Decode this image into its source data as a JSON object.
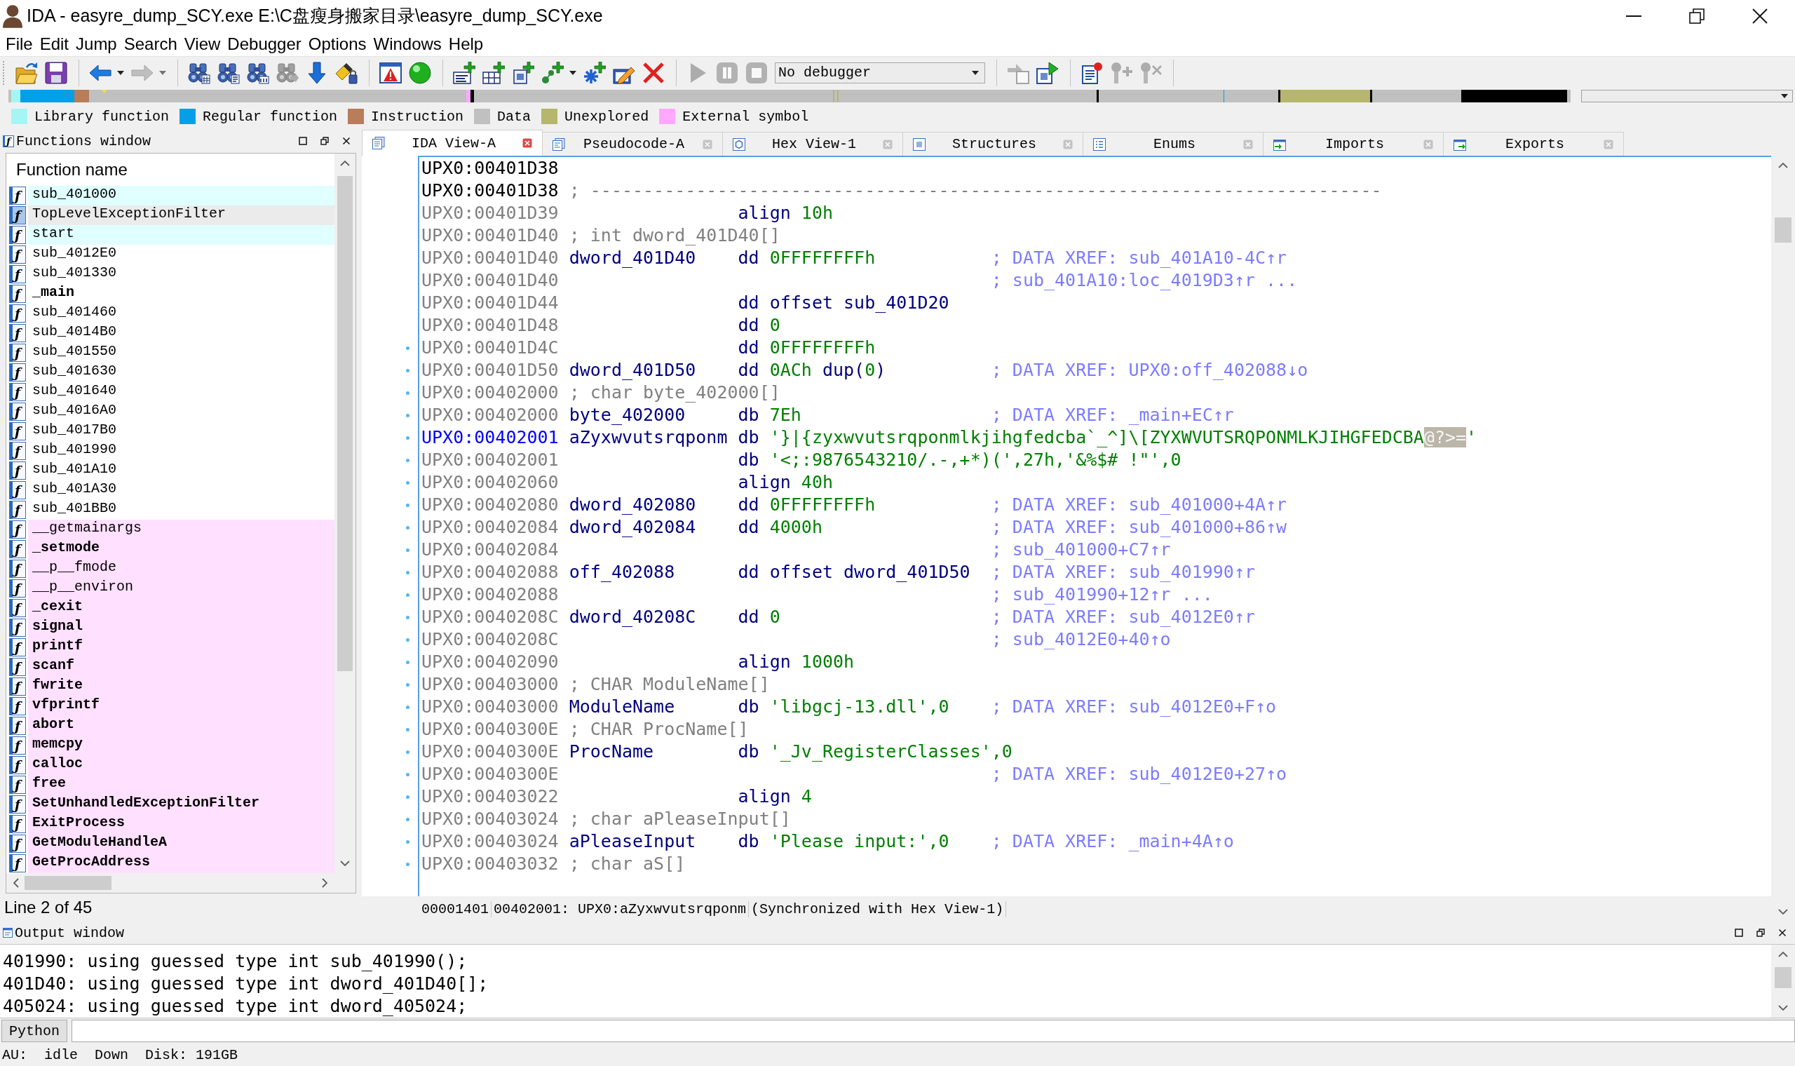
{
  "window": {
    "title": "IDA - easyre_dump_SCY.exe E:\\C盘瘦身搬家目录\\easyre_dump_SCY.exe"
  },
  "menu": [
    "File",
    "Edit",
    "Jump",
    "Search",
    "View",
    "Debugger",
    "Options",
    "Windows",
    "Help"
  ],
  "toolbar": [
    [
      {
        "kind": "open",
        "disabled": false,
        "dropdown": false
      },
      {
        "kind": "save",
        "disabled": false,
        "dropdown": false
      }
    ],
    [
      {
        "kind": "back",
        "disabled": false,
        "dropdown": true
      },
      {
        "kind": "forward",
        "disabled": true,
        "dropdown": true
      }
    ],
    [
      {
        "kind": "findhex",
        "disabled": false,
        "dropdown": false
      },
      {
        "kind": "findtext",
        "disabled": false,
        "dropdown": false
      },
      {
        "kind": "findbinary",
        "disabled": false,
        "dropdown": false
      },
      {
        "kind": "findnext",
        "disabled": true,
        "dropdown": false
      },
      {
        "kind": "jump",
        "disabled": false,
        "dropdown": false
      },
      {
        "kind": "lock",
        "disabled": false,
        "dropdown": false
      }
    ],
    [
      {
        "kind": "warning",
        "disabled": false,
        "dropdown": false
      },
      {
        "kind": "ball",
        "disabled": false,
        "dropdown": false
      }
    ],
    [
      {
        "kind": "addcode",
        "disabled": false,
        "dropdown": false
      },
      {
        "kind": "adddata",
        "disabled": false,
        "dropdown": false
      },
      {
        "kind": "addtext",
        "disabled": false,
        "dropdown": false
      },
      {
        "kind": "addstruct",
        "disabled": false,
        "dropdown": true
      },
      {
        "kind": "addenum",
        "disabled": false,
        "dropdown": false
      },
      {
        "kind": "edit",
        "disabled": false,
        "dropdown": false
      },
      {
        "kind": "delete",
        "disabled": false,
        "dropdown": false
      }
    ],
    [
      {
        "kind": "play",
        "disabled": true,
        "dropdown": false
      },
      {
        "kind": "pause",
        "disabled": true,
        "dropdown": false
      },
      {
        "kind": "stop",
        "disabled": true,
        "dropdown": false
      },
      {
        "kind": "select",
        "value": "No debugger",
        "disabled": false,
        "dropdown": true
      }
    ],
    [
      {
        "kind": "attach",
        "disabled": true,
        "dropdown": false
      },
      {
        "kind": "run",
        "disabled": false,
        "dropdown": false
      }
    ],
    [
      {
        "kind": "notes",
        "disabled": false,
        "dropdown": false
      },
      {
        "kind": "pinadd",
        "disabled": true,
        "dropdown": false
      },
      {
        "kind": "pindel",
        "disabled": true,
        "dropdown": false
      }
    ]
  ],
  "legend": [
    {
      "label": "Library function",
      "color": "#a6f5f5"
    },
    {
      "label": "Regular function",
      "color": "#03a0e8"
    },
    {
      "label": "Instruction",
      "color": "#b87d5b"
    },
    {
      "label": "Data",
      "color": "#c0c0c0"
    },
    {
      "label": "Unexplored",
      "color": "#b6b66e"
    },
    {
      "label": "External symbol",
      "color": "#ffa8ff"
    }
  ],
  "functions_window": {
    "title": "Functions window",
    "icon": "ƒ",
    "column": "Function name",
    "functions": [
      {
        "icon": "ƒ",
        "name": "sub_401000",
        "kind": "library",
        "bold": false,
        "selected": false
      },
      {
        "icon": "ƒ",
        "name": "TopLevelExceptionFilter",
        "kind": "regular",
        "bold": false,
        "selected": true
      },
      {
        "icon": "ƒ",
        "name": "start",
        "kind": "library",
        "bold": false,
        "selected": false
      },
      {
        "icon": "ƒ",
        "name": "sub_4012E0",
        "kind": "regular",
        "bold": false,
        "selected": false
      },
      {
        "icon": "ƒ",
        "name": "sub_401330",
        "kind": "regular",
        "bold": false,
        "selected": false
      },
      {
        "icon": "ƒ",
        "name": "_main",
        "kind": "regular",
        "bold": true,
        "selected": false
      },
      {
        "icon": "ƒ",
        "name": "sub_401460",
        "kind": "regular",
        "bold": false,
        "selected": false
      },
      {
        "icon": "ƒ",
        "name": "sub_4014B0",
        "kind": "regular",
        "bold": false,
        "selected": false
      },
      {
        "icon": "ƒ",
        "name": "sub_401550",
        "kind": "regular",
        "bold": false,
        "selected": false
      },
      {
        "icon": "ƒ",
        "name": "sub_401630",
        "kind": "regular",
        "bold": false,
        "selected": false
      },
      {
        "icon": "ƒ",
        "name": "sub_401640",
        "kind": "regular",
        "bold": false,
        "selected": false
      },
      {
        "icon": "ƒ",
        "name": "sub_4016A0",
        "kind": "regular",
        "bold": false,
        "selected": false
      },
      {
        "icon": "ƒ",
        "name": "sub_4017B0",
        "kind": "regular",
        "bold": false,
        "selected": false
      },
      {
        "icon": "ƒ",
        "name": "sub_401990",
        "kind": "regular",
        "bold": false,
        "selected": false
      },
      {
        "icon": "ƒ",
        "name": "sub_401A10",
        "kind": "regular",
        "bold": false,
        "selected": false
      },
      {
        "icon": "ƒ",
        "name": "sub_401A30",
        "kind": "regular",
        "bold": false,
        "selected": false
      },
      {
        "icon": "ƒ",
        "name": "sub_401BB0",
        "kind": "regular",
        "bold": false,
        "selected": false
      },
      {
        "icon": "ƒ",
        "name": "__getmainargs",
        "kind": "external",
        "bold": false,
        "selected": false
      },
      {
        "icon": "ƒ",
        "name": "_setmode",
        "kind": "external",
        "bold": true,
        "selected": false
      },
      {
        "icon": "ƒ",
        "name": "__p__fmode",
        "kind": "external",
        "bold": false,
        "selected": false
      },
      {
        "icon": "ƒ",
        "name": "__p__environ",
        "kind": "external",
        "bold": false,
        "selected": false
      },
      {
        "icon": "ƒ",
        "name": "_cexit",
        "kind": "external",
        "bold": true,
        "selected": false
      },
      {
        "icon": "ƒ",
        "name": "signal",
        "kind": "external",
        "bold": true,
        "selected": false
      },
      {
        "icon": "ƒ",
        "name": "printf",
        "kind": "external",
        "bold": true,
        "selected": false
      },
      {
        "icon": "ƒ",
        "name": "scanf",
        "kind": "external",
        "bold": true,
        "selected": false
      },
      {
        "icon": "ƒ",
        "name": "fwrite",
        "kind": "external",
        "bold": true,
        "selected": false
      },
      {
        "icon": "ƒ",
        "name": "vfprintf",
        "kind": "external",
        "bold": true,
        "selected": false
      },
      {
        "icon": "ƒ",
        "name": "abort",
        "kind": "external",
        "bold": true,
        "selected": false
      },
      {
        "icon": "ƒ",
        "name": "memcpy",
        "kind": "external",
        "bold": true,
        "selected": false
      },
      {
        "icon": "ƒ",
        "name": "calloc",
        "kind": "external",
        "bold": true,
        "selected": false
      },
      {
        "icon": "ƒ",
        "name": "free",
        "kind": "external",
        "bold": true,
        "selected": false
      },
      {
        "icon": "ƒ",
        "name": "SetUnhandledExceptionFilter",
        "kind": "external",
        "bold": true,
        "selected": false
      },
      {
        "icon": "ƒ",
        "name": "ExitProcess",
        "kind": "external",
        "bold": true,
        "selected": false
      },
      {
        "icon": "ƒ",
        "name": "GetModuleHandleA",
        "kind": "external",
        "bold": true,
        "selected": false
      },
      {
        "icon": "ƒ",
        "name": "GetProcAddress",
        "kind": "external",
        "bold": true,
        "selected": false
      }
    ],
    "status": "Line 2 of 45"
  },
  "tabs": [
    {
      "label": "IDA View-A",
      "kind": "disassembly",
      "selected": true
    },
    {
      "label": "Pseudocode-A",
      "kind": "pseudocode",
      "selected": false
    },
    {
      "label": "Hex View-1",
      "kind": "hex",
      "selected": false
    },
    {
      "label": "Structures",
      "kind": "structures",
      "selected": false
    },
    {
      "label": "Enums",
      "kind": "enums",
      "selected": false
    },
    {
      "label": "Imports",
      "kind": "imports",
      "selected": false
    },
    {
      "label": "Exports",
      "kind": "exports",
      "selected": false
    }
  ],
  "disassembly": {
    "lines": [
      {
        "address": "UPX0:00401D38",
        "kind": "code",
        "selected": false,
        "marked": false
      },
      {
        "address": "UPX0:00401D38",
        "kind": "code",
        "selected": false,
        "marked": false,
        "note": "; ---------------------------------------------------------------------------"
      },
      {
        "address": "UPX0:00401D39",
        "kind": "data",
        "selected": false,
        "marked": false,
        "mnemonic": "align",
        "operands": [
          {
            "text": "10h",
            "kind": "value"
          }
        ]
      },
      {
        "address": "UPX0:00401D40",
        "kind": "data",
        "selected": false,
        "marked": false,
        "note": "; int dword_401D40[]"
      },
      {
        "address": "UPX0:00401D40",
        "kind": "data",
        "selected": false,
        "marked": false,
        "label": "dword_401D40",
        "mnemonic": "dd",
        "operands": [
          {
            "text": "0FFFFFFFFh",
            "kind": "value"
          }
        ],
        "comment": "; DATA XREF: sub_401A10-4C↑r"
      },
      {
        "address": "UPX0:00401D40",
        "kind": "data",
        "selected": false,
        "marked": false,
        "comment": "; sub_401A10:loc_4019D3↑r ..."
      },
      {
        "address": "UPX0:00401D44",
        "kind": "data",
        "selected": false,
        "marked": false,
        "mnemonic": "dd",
        "operands": [
          {
            "text": "offset sub_401D20",
            "kind": "symbol"
          }
        ]
      },
      {
        "address": "UPX0:00401D48",
        "kind": "data",
        "selected": false,
        "marked": false,
        "mnemonic": "dd",
        "operands": [
          {
            "text": "0",
            "kind": "value"
          }
        ]
      },
      {
        "address": "UPX0:00401D4C",
        "kind": "data",
        "selected": false,
        "marked": true,
        "mnemonic": "dd",
        "operands": [
          {
            "text": "0FFFFFFFFh",
            "kind": "value"
          }
        ]
      },
      {
        "address": "UPX0:00401D50",
        "kind": "data",
        "selected": false,
        "marked": true,
        "label": "dword_401D50",
        "mnemonic": "dd",
        "operands": [
          {
            "text": "0ACh",
            "kind": "value"
          },
          {
            "text": " dup(",
            "kind": "symbol"
          },
          {
            "text": "0",
            "kind": "value"
          },
          {
            "text": ")",
            "kind": "symbol"
          }
        ],
        "comment": "; DATA XREF: UPX0:off_402088↓o"
      },
      {
        "address": "UPX0:00402000",
        "kind": "data",
        "selected": false,
        "marked": true,
        "note": "; char byte_402000[]"
      },
      {
        "address": "UPX0:00402000",
        "kind": "data",
        "selected": false,
        "marked": true,
        "label": "byte_402000",
        "mnemonic": "db",
        "operands": [
          {
            "text": "7Eh",
            "kind": "value"
          }
        ],
        "comment": "; DATA XREF: _main+EC↑r"
      },
      {
        "address": "UPX0:00402001",
        "kind": "data",
        "selected": true,
        "marked": true,
        "label": "aZyxwvutsrqponm",
        "mnemonic": "db",
        "operands": [
          {
            "text": "'}|{zyxwvutsrqponmlkjihgfedcba`_^]\\[ZYXWVUTSRQPONMLKJIHGFEDCBA",
            "kind": "value"
          },
          {
            "text": "@?>=",
            "kind": "highlight"
          },
          {
            "text": "'",
            "kind": "value"
          }
        ]
      },
      {
        "address": "UPX0:00402001",
        "kind": "data",
        "selected": false,
        "marked": true,
        "mnemonic": "db",
        "operands": [
          {
            "text": "'<;:9876543210/.-,+*)(',27h,'&%$# !\"',0",
            "kind": "value"
          }
        ]
      },
      {
        "address": "UPX0:00402060",
        "kind": "data",
        "selected": false,
        "marked": true,
        "mnemonic": "align",
        "operands": [
          {
            "text": "40h",
            "kind": "value"
          }
        ]
      },
      {
        "address": "UPX0:00402080",
        "kind": "data",
        "selected": false,
        "marked": true,
        "label": "dword_402080",
        "mnemonic": "dd",
        "operands": [
          {
            "text": "0FFFFFFFFh",
            "kind": "value"
          }
        ],
        "comment": "; DATA XREF: sub_401000+4A↑r"
      },
      {
        "address": "UPX0:00402084",
        "kind": "data",
        "selected": false,
        "marked": true,
        "label": "dword_402084",
        "mnemonic": "dd",
        "operands": [
          {
            "text": "4000h",
            "kind": "value"
          }
        ],
        "comment": "; DATA XREF: sub_401000+86↑w"
      },
      {
        "address": "UPX0:00402084",
        "kind": "data",
        "selected": false,
        "marked": true,
        "comment": "; sub_401000+C7↑r"
      },
      {
        "address": "UPX0:00402088",
        "kind": "data",
        "selected": false,
        "marked": true,
        "label": "off_402088",
        "mnemonic": "dd",
        "operands": [
          {
            "text": "offset dword_401D50",
            "kind": "symbol"
          }
        ],
        "comment": "; DATA XREF: sub_401990↑r"
      },
      {
        "address": "UPX0:00402088",
        "kind": "data",
        "selected": false,
        "marked": true,
        "comment": "; sub_401990+12↑r ..."
      },
      {
        "address": "UPX0:0040208C",
        "kind": "data",
        "selected": false,
        "marked": true,
        "label": "dword_40208C",
        "mnemonic": "dd",
        "operands": [
          {
            "text": "0",
            "kind": "value"
          }
        ],
        "comment": "; DATA XREF: sub_4012E0↑r"
      },
      {
        "address": "UPX0:0040208C",
        "kind": "data",
        "selected": false,
        "marked": true,
        "comment": "; sub_4012E0+40↑o"
      },
      {
        "address": "UPX0:00402090",
        "kind": "data",
        "selected": false,
        "marked": true,
        "mnemonic": "align",
        "operands": [
          {
            "text": "1000h",
            "kind": "value"
          }
        ]
      },
      {
        "address": "UPX0:00403000",
        "kind": "data",
        "selected": false,
        "marked": true,
        "note": "; CHAR ModuleName[]"
      },
      {
        "address": "UPX0:00403000",
        "kind": "data",
        "selected": false,
        "marked": true,
        "label": "ModuleName",
        "mnemonic": "db",
        "operands": [
          {
            "text": "'libgcj-13.dll',0",
            "kind": "value"
          }
        ],
        "comment": "; DATA XREF: sub_4012E0+F↑o"
      },
      {
        "address": "UPX0:0040300E",
        "kind": "data",
        "selected": false,
        "marked": true,
        "note": "; CHAR ProcName[]"
      },
      {
        "address": "UPX0:0040300E",
        "kind": "data",
        "selected": false,
        "marked": true,
        "label": "ProcName",
        "mnemonic": "db",
        "operands": [
          {
            "text": "'_Jv_RegisterClasses',0",
            "kind": "value"
          }
        ]
      },
      {
        "address": "UPX0:0040300E",
        "kind": "data",
        "selected": false,
        "marked": true,
        "comment": "; DATA XREF: sub_4012E0+27↑o"
      },
      {
        "address": "UPX0:00403022",
        "kind": "data",
        "selected": false,
        "marked": true,
        "mnemonic": "align",
        "operands": [
          {
            "text": "4",
            "kind": "value"
          }
        ]
      },
      {
        "address": "UPX0:00403024",
        "kind": "data",
        "selected": false,
        "marked": true,
        "note": "; char aPleaseInput[]"
      },
      {
        "address": "UPX0:00403024",
        "kind": "data",
        "selected": false,
        "marked": true,
        "label": "aPleaseInput",
        "mnemonic": "db",
        "operands": [
          {
            "text": "'Please input:',0",
            "kind": "value"
          }
        ],
        "comment": "; DATA XREF: _main+4A↑o"
      },
      {
        "address": "UPX0:00403032",
        "kind": "data",
        "selected": false,
        "marked": true,
        "note": "; char aS[]"
      }
    ],
    "status": [
      "00001401",
      "00402001: UPX0:aZyxwvutsrqponm",
      "(Synchronized with Hex View-1)"
    ]
  },
  "output_window": {
    "title": "Output window",
    "lines": [
      "401990: using guessed type int sub_401990();",
      "401D40: using guessed type int dword_401D40[];",
      "405024: using guessed type int dword_405024;"
    ]
  },
  "command_line": {
    "language_button": "Python"
  },
  "status_bar": [
    "AU:",
    "idle",
    "Down",
    "Disk: 191GB"
  ]
}
